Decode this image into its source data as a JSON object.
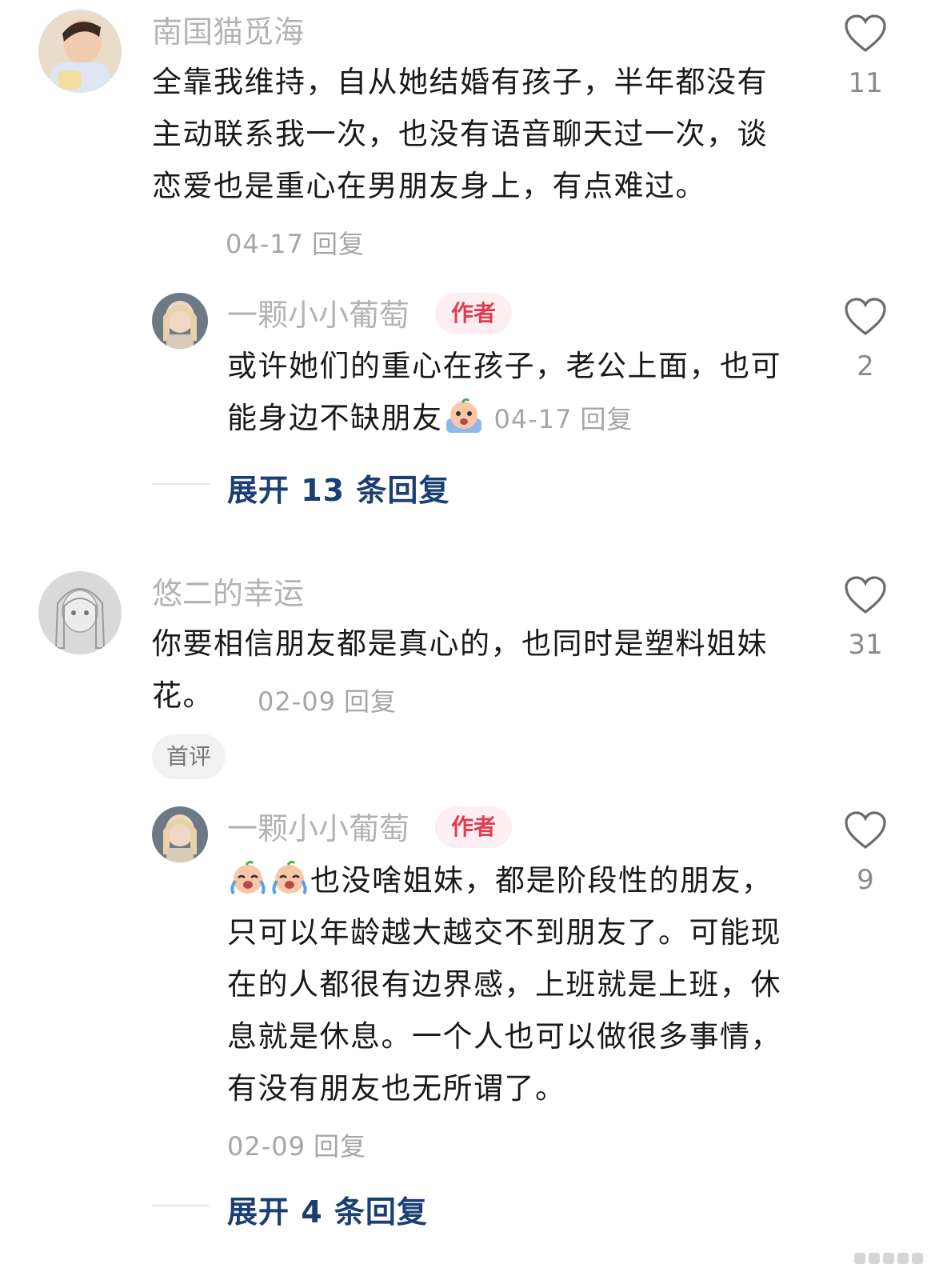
{
  "comments": [
    {
      "user": "南国猫觅海",
      "text": "全靠我维持，自从她结婚有孩子，半年都没有主动联系我一次，也没有语音聊天过一次，谈恋爱也是重心在男朋友身上，有点难过。",
      "date": "04-17",
      "reply_label": "回复",
      "likes": "11",
      "reply": {
        "user": "一颗小小葡萄",
        "badge": "作者",
        "text": "或许她们的重心在孩子，老公上面，也可能身边不缺朋友",
        "emoji": "crying-face-emoji",
        "date": "04-17",
        "reply_label": "回复",
        "likes": "2"
      },
      "expand": "展开 13 条回复"
    },
    {
      "user": "悠二的幸运",
      "text": "你要相信朋友都是真心的，也同时是塑料姐妹花。",
      "date": "02-09",
      "reply_label": "回复",
      "likes": "31",
      "tag": "首评",
      "reply": {
        "user": "一颗小小葡萄",
        "badge": "作者",
        "emoji": "crying-face-emoji",
        "text": "也没啥姐妹，都是阶段性的朋友，只可以年龄越大越交不到朋友了。可能现在的人都很有边界感，上班就是上班，休息就是休息。一个人也可以做很多事情，有没有朋友也无所谓了。",
        "date": "02-09",
        "reply_label": "回复",
        "likes": "9"
      },
      "expand": "展开 4 条回复"
    }
  ],
  "colors": {
    "accent_link": "#1c3f73",
    "author_badge": "#e23d52",
    "muted": "#a6a6a6"
  }
}
